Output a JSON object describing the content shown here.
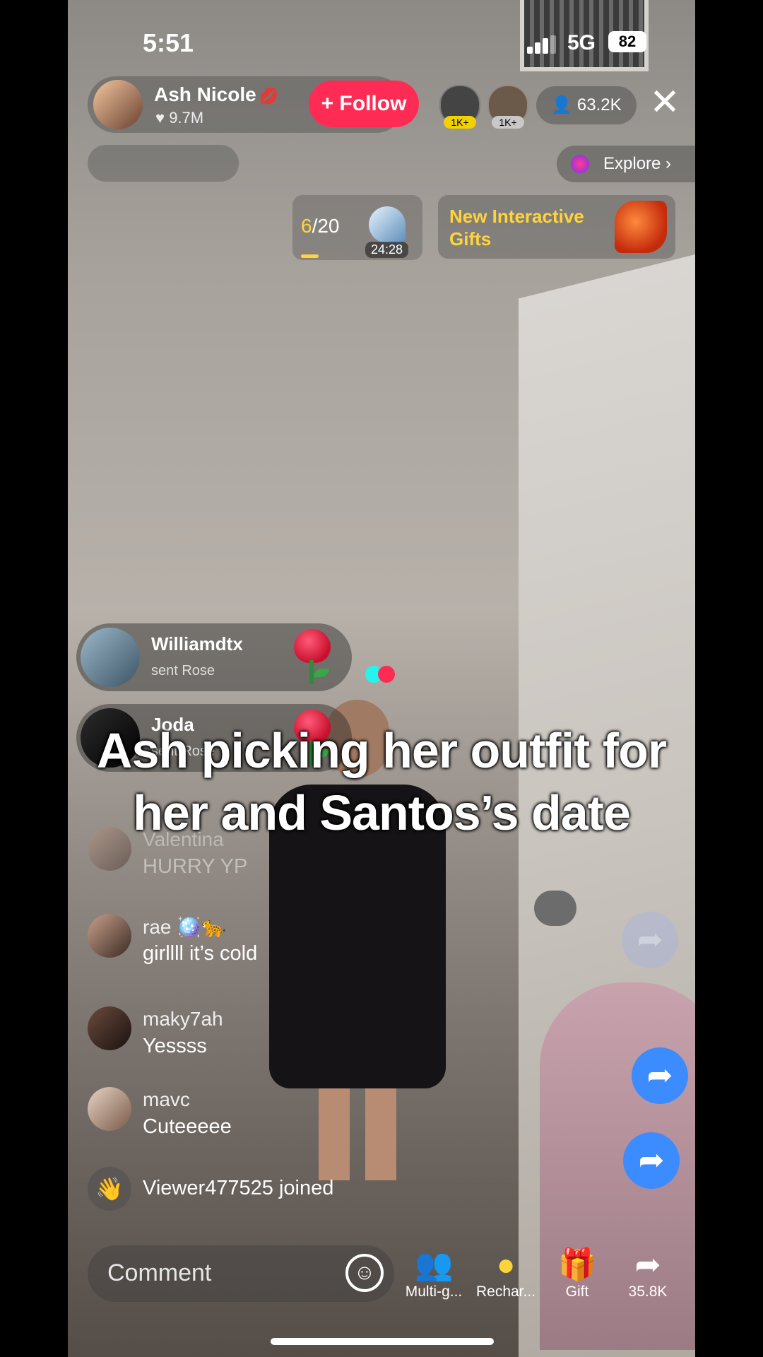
{
  "status_bar": {
    "time": "5:51",
    "network": "5G",
    "battery": "82"
  },
  "host": {
    "name": "Ash Nicole",
    "likes": "9.7M",
    "follow_label": "+ Follow"
  },
  "top_viewers": [
    {
      "badge": "1K+",
      "badge_color": "#f1d100"
    },
    {
      "badge": "1K+",
      "badge_color": "#c8c8c8"
    }
  ],
  "viewer_count": "63.2K",
  "explore_label": "Explore",
  "goal": {
    "current": "6",
    "total": "/20",
    "timer": "24:28",
    "progress": 0.3
  },
  "gifts_banner": {
    "text": "New Interactive Gifts"
  },
  "gift_notifications": [
    {
      "user": "Williamdtx",
      "action": "sent Rose"
    },
    {
      "user": "Joda",
      "action": "sent Rose"
    }
  ],
  "caption": {
    "line1": "Ash picking her outfit for",
    "line2": "her and Santos’s date"
  },
  "chat": [
    {
      "user": "Valentina",
      "message": "HURRY YP",
      "faded": true
    },
    {
      "user": "rae 🪩🐆",
      "message": "girllll it’s cold"
    },
    {
      "user": "maky7ah",
      "message": "Yessss"
    },
    {
      "user": "mavc",
      "message": "Cuteeeee"
    }
  ],
  "join_notice": "Viewer477525 joined",
  "bottom_bar": {
    "comment_placeholder": "Comment",
    "actions": [
      {
        "label": "Multi-g...",
        "icon": "multi-guest-icon"
      },
      {
        "label": "Rechar...",
        "icon": "recharge-icon"
      },
      {
        "label": "Gift",
        "icon": "gift-icon"
      },
      {
        "label": "35.8K",
        "icon": "share-icon"
      }
    ]
  },
  "colors": {
    "follow": "#fe2c55",
    "highlight": "#ffd43b",
    "share": "#3c8cff"
  }
}
